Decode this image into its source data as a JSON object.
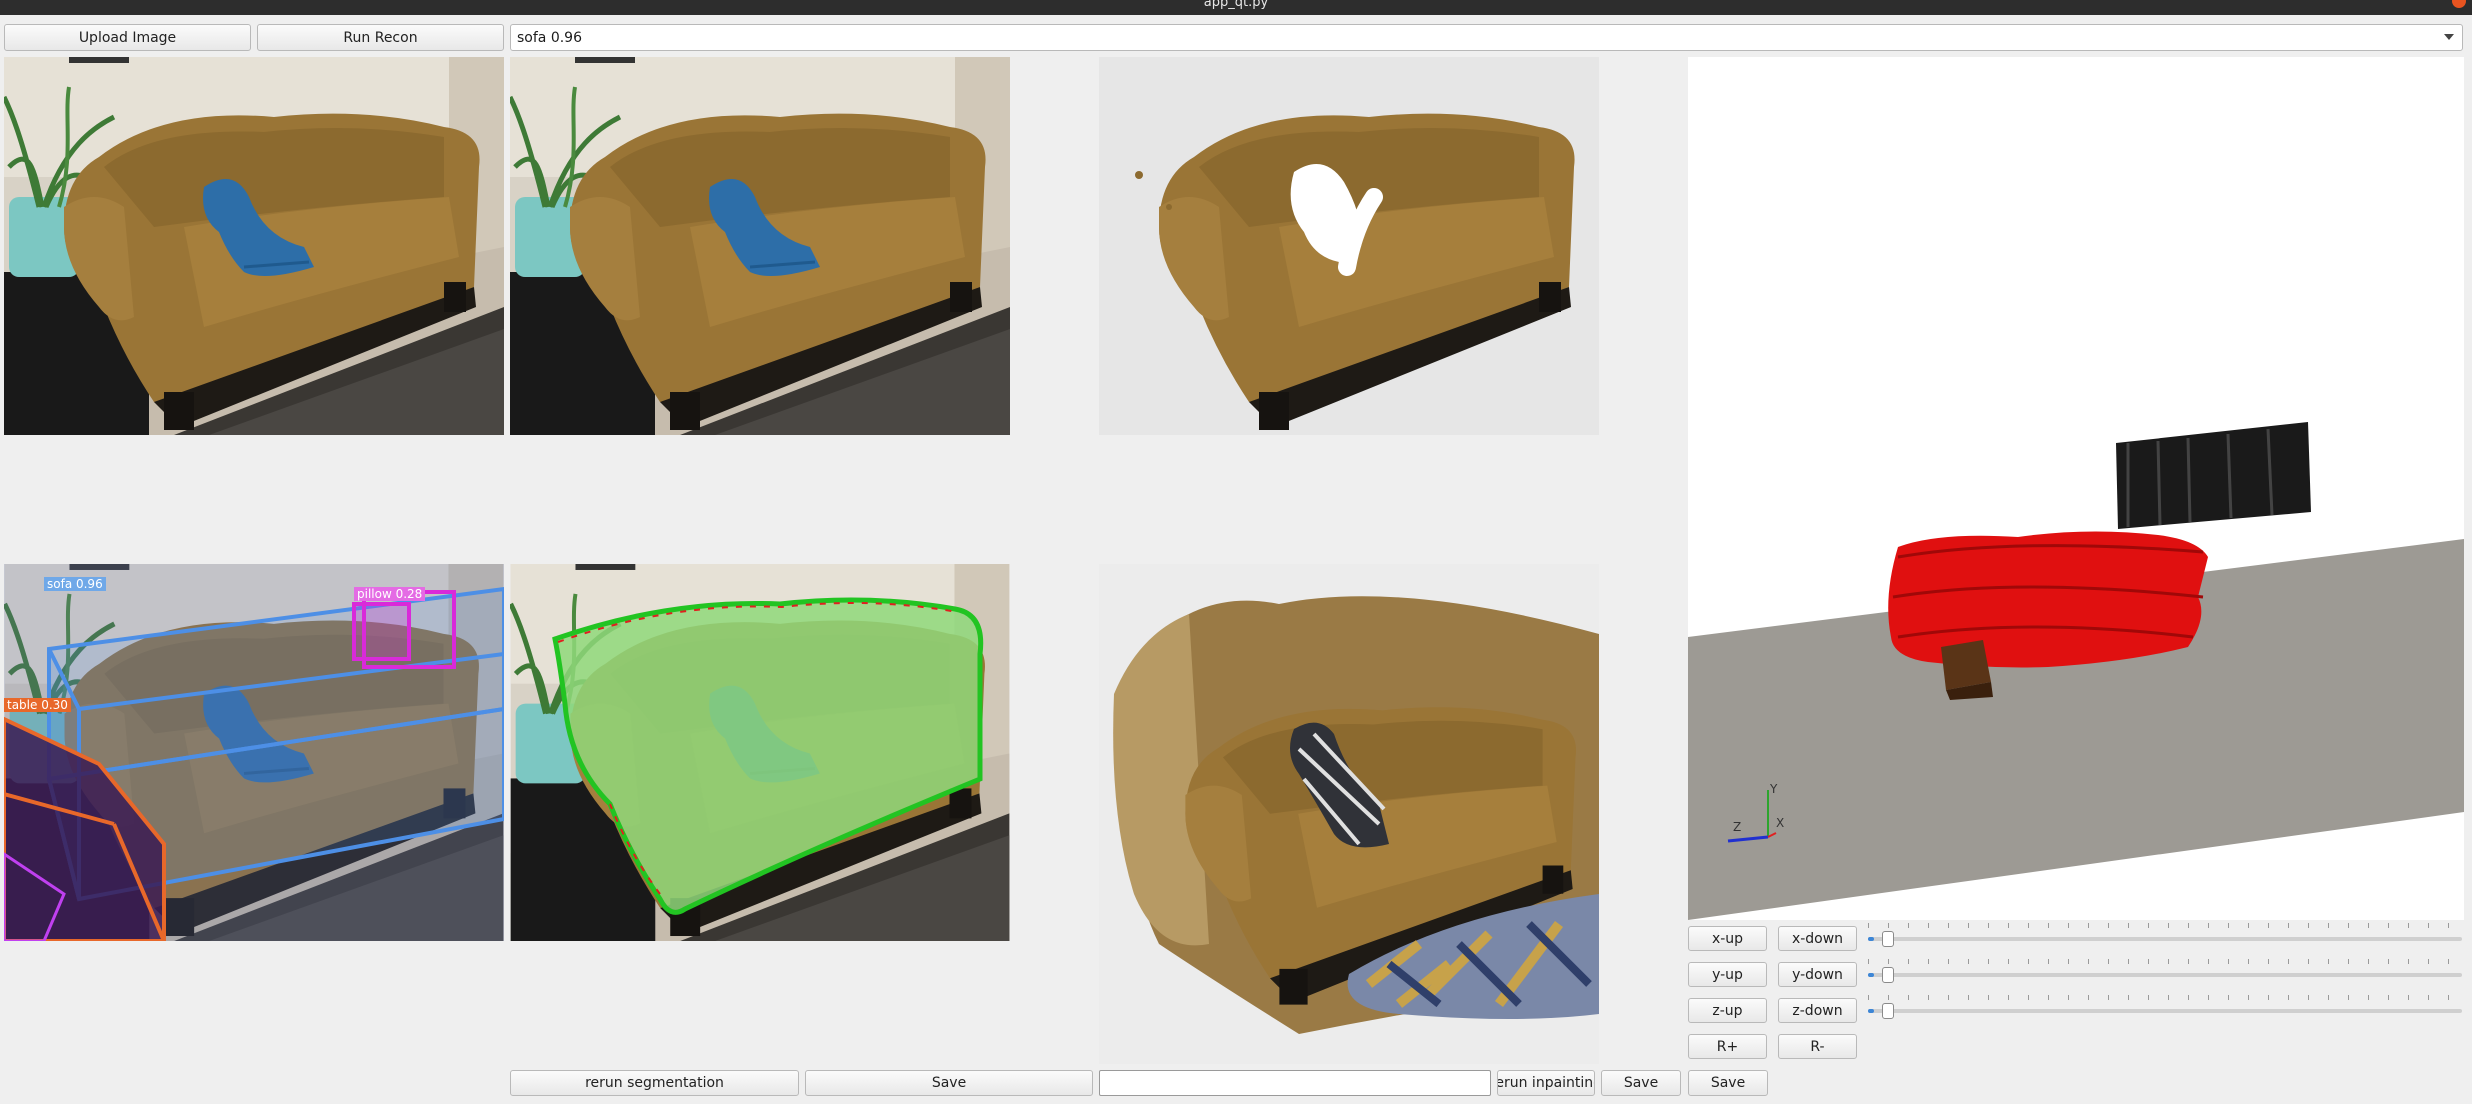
{
  "window": {
    "title": "app_qt.py"
  },
  "toolbar": {
    "upload_label": "Upload Image",
    "run_label": "Run Recon",
    "object_select_value": "sofa 0.96"
  },
  "detections": {
    "sofa": "sofa 0.96",
    "pillow": "pillow 0.28",
    "table": "table 0.30"
  },
  "axes": {
    "x": "X",
    "y": "Y",
    "z": "Z"
  },
  "controls": {
    "x_up": "x-up",
    "x_down": "x-down",
    "y_up": "y-up",
    "y_down": "y-down",
    "z_up": "z-up",
    "z_down": "z-down",
    "r_plus": "R+",
    "r_minus": "R-"
  },
  "sliders": {
    "x_level": 0.01,
    "y_level": 0.01,
    "z_level": 0.01
  },
  "bottom": {
    "rerun_segmentation_label": "rerun segmentation",
    "save_seg_label": "Save",
    "prompt_value": "",
    "rerun_inpainting_label": "rerun inpainting",
    "save_inpaint_label": "Save",
    "save_scene_label": "Save"
  },
  "colors": {
    "sofa": "#9a7536",
    "mask_green": "#8fd87a",
    "box_blue": "#4d8fe6",
    "box_magenta": "#d92ad9",
    "box_orange": "#e8682a",
    "recon_red": "#e01010",
    "floor": "#9d9a94"
  }
}
